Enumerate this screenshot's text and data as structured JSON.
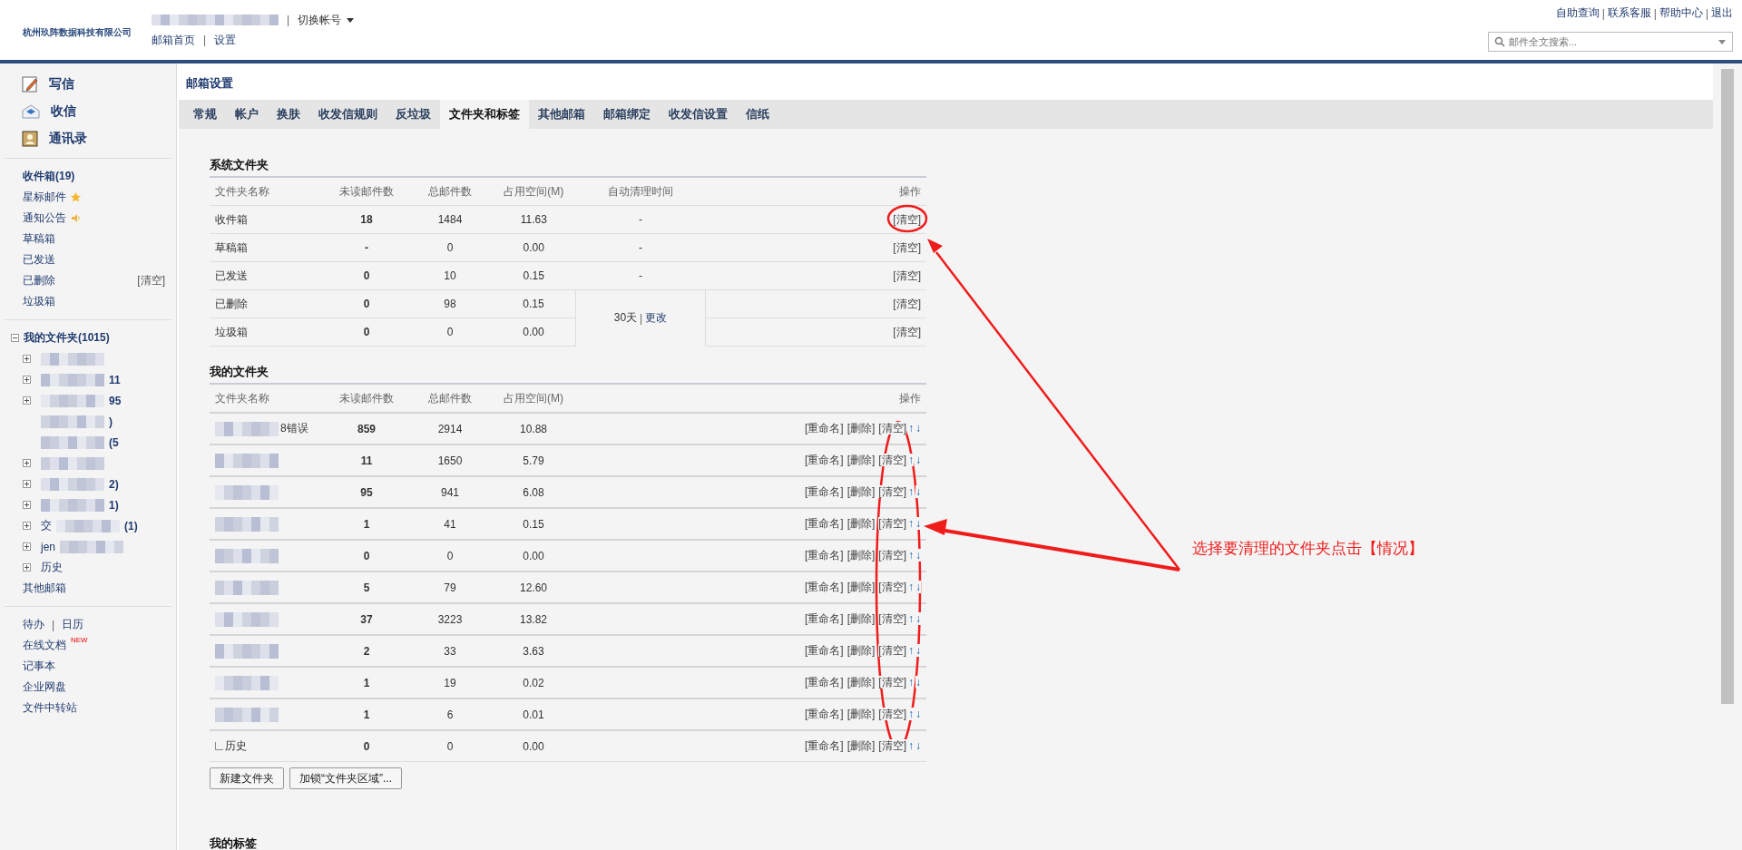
{
  "header": {
    "company": "杭州玖阵数据科技有限公司",
    "account_sep": "|",
    "switch_account": "切换帐号",
    "nav": [
      {
        "kind": "link",
        "text": "邮箱首页"
      },
      {
        "kind": "sep",
        "text": "|"
      },
      {
        "kind": "link",
        "text": "设置"
      }
    ],
    "top_links": [
      {
        "kind": "link",
        "text": "自助查询"
      },
      {
        "kind": "sep",
        "text": "|"
      },
      {
        "kind": "link",
        "text": "联系客服"
      },
      {
        "kind": "sep",
        "text": "|"
      },
      {
        "kind": "link",
        "text": "帮助中心"
      },
      {
        "kind": "sep",
        "text": "|"
      },
      {
        "kind": "link",
        "text": "退出"
      }
    ],
    "search": {
      "placeholder": "邮件全文搜索..."
    }
  },
  "sidebar": {
    "actions": [
      {
        "kind": "compose",
        "label": "写信"
      },
      {
        "kind": "inbox",
        "label": "收信"
      },
      {
        "kind": "contacts",
        "label": "通讯录"
      }
    ],
    "folders": [
      {
        "kind": "plain",
        "label": "收件箱(19)",
        "bold": true
      },
      {
        "kind": "starred",
        "label": "星标邮件",
        "bold": false
      },
      {
        "kind": "notice",
        "label": "通知公告",
        "bold": false
      },
      {
        "kind": "plain",
        "label": "草稿箱",
        "bold": false
      },
      {
        "kind": "plain",
        "label": "已发送",
        "bold": false
      },
      {
        "kind": "plain",
        "label": "已删除",
        "bold": false,
        "action": "[清空]"
      },
      {
        "kind": "plain",
        "label": "垃圾箱",
        "bold": false
      }
    ],
    "my_folders": {
      "label": "我的文件夹(1015)",
      "expanded": true,
      "children": [
        {
          "blurred": true,
          "expander": true
        },
        {
          "blurred": true,
          "suffix": "11",
          "expander": true
        },
        {
          "blurred": true,
          "suffix": "95",
          "expander": true
        },
        {
          "blurred": true,
          "suffix": ")",
          "expander": false
        },
        {
          "blurred": true,
          "suffix": "(5",
          "expander": false
        },
        {
          "blurred": true,
          "expander": true
        },
        {
          "blurred": true,
          "suffix": "2)",
          "expander": true
        },
        {
          "blurred": true,
          "suffix": "1)",
          "expander": true
        },
        {
          "blurred": true,
          "prefix": "交",
          "suffix": "(1)",
          "expander": true
        },
        {
          "blurred": true,
          "prefix": "jen",
          "expander": true
        },
        {
          "blurred": false,
          "prefix": "历史",
          "expander": true
        }
      ]
    },
    "other": "其他邮箱",
    "tools": [
      {
        "links": [
          {
            "kind": "link",
            "text": "待办"
          },
          {
            "kind": "sep",
            "text": "|"
          },
          {
            "kind": "link",
            "text": "日历"
          }
        ]
      },
      {
        "links": [
          {
            "kind": "link",
            "text": "在线文档"
          }
        ],
        "badge": "NEW"
      },
      {
        "links": [
          {
            "kind": "link",
            "text": "记事本"
          }
        ]
      },
      {
        "links": [
          {
            "kind": "link",
            "text": "企业网盘"
          }
        ]
      },
      {
        "links": [
          {
            "kind": "link",
            "text": "文件中转站"
          }
        ]
      }
    ]
  },
  "page_title": "邮箱设置",
  "tabs": [
    {
      "label": "常规",
      "selected": false
    },
    {
      "label": "帐户",
      "selected": false
    },
    {
      "label": "换肤",
      "selected": false
    },
    {
      "label": "收发信规则",
      "selected": false
    },
    {
      "label": "反垃圾",
      "selected": false
    },
    {
      "label": "文件夹和标签",
      "selected": true
    },
    {
      "label": "其他邮箱",
      "selected": false
    },
    {
      "label": "邮箱绑定",
      "selected": false
    },
    {
      "label": "收发信设置",
      "selected": false
    },
    {
      "label": "信纸",
      "selected": false
    }
  ],
  "system_folders": {
    "title": "系统文件夹",
    "columns": [
      "文件夹名称",
      "未读邮件数",
      "总邮件数",
      "占用空间(M)",
      "自动清理时间",
      "操作"
    ],
    "rows": [
      {
        "name": "收件箱",
        "unread": "18",
        "total": "1484",
        "size": "11.63",
        "auto": "-",
        "action": "[清空]"
      },
      {
        "name": "草稿箱",
        "unread": "-",
        "total": "0",
        "size": "0.00",
        "auto": "-",
        "action": "[清空]"
      },
      {
        "name": "已发送",
        "unread": "0",
        "total": "10",
        "size": "0.15",
        "auto": "-",
        "action": "[清空]"
      },
      {
        "name": "已删除",
        "unread": "0",
        "total": "98",
        "size": "0.15",
        "action": "[清空]"
      },
      {
        "name": "垃圾箱",
        "unread": "0",
        "total": "0",
        "size": "0.00",
        "action": "[清空]"
      }
    ],
    "auto_clean": {
      "days": "30天",
      "sep": "|",
      "link": "更改"
    }
  },
  "my_folders_table": {
    "title": "我的文件夹",
    "columns": [
      "文件夹名称",
      "未读邮件数",
      "总邮件数",
      "占用空间(M)",
      "操作"
    ],
    "rows": [
      {
        "name": "8错误",
        "blurred": true,
        "unread": "859",
        "total": "2914",
        "size": "10.88",
        "actions": [
          "[重命名]",
          "[删除]",
          "[清空]",
          "↑",
          "↓"
        ]
      },
      {
        "blurred": true,
        "unread": "11",
        "total": "1650",
        "size": "5.79",
        "actions": [
          "[重命名]",
          "[删除]",
          "[清空]",
          "↑",
          "↓"
        ]
      },
      {
        "blurred": true,
        "unread": "95",
        "total": "941",
        "size": "6.08",
        "actions": [
          "[重命名]",
          "[删除]",
          "[清空]",
          "↑",
          "↓"
        ]
      },
      {
        "blurred": true,
        "unread": "1",
        "total": "41",
        "size": "0.15",
        "actions": [
          "[重命名]",
          "[删除]",
          "[清空]",
          "↑",
          "↓"
        ]
      },
      {
        "blurred": true,
        "unread": "0",
        "total": "0",
        "size": "0.00",
        "actions": [
          "[重命名]",
          "[删除]",
          "[清空]",
          "↑",
          "↓"
        ]
      },
      {
        "blurred": true,
        "unread": "5",
        "total": "79",
        "size": "12.60",
        "actions": [
          "[重命名]",
          "[删除]",
          "[清空]",
          "↑",
          "↓"
        ]
      },
      {
        "blurred": true,
        "unread": "37",
        "total": "3223",
        "size": "13.82",
        "actions": [
          "[重命名]",
          "[删除]",
          "[清空]",
          "↑",
          "↓"
        ]
      },
      {
        "blurred": true,
        "unread": "2",
        "total": "33",
        "size": "3.63",
        "actions": [
          "[重命名]",
          "[删除]",
          "[清空]",
          "↑",
          "↓"
        ]
      },
      {
        "blurred": true,
        "unread": "1",
        "total": "19",
        "size": "0.02",
        "actions": [
          "[重命名]",
          "[删除]",
          "[清空]",
          "↑",
          "↓"
        ]
      },
      {
        "blurred": true,
        "unread": "1",
        "total": "6",
        "size": "0.01",
        "actions": [
          "[重命名]",
          "[删除]",
          "[清空]",
          "↑",
          "↓"
        ]
      },
      {
        "name": "历史",
        "blurred": false,
        "unread": "0",
        "total": "0",
        "size": "0.00",
        "actions": [
          "[重命名]",
          "[删除]",
          "[清空]",
          "↑",
          "↓"
        ]
      }
    ],
    "buttons": [
      "新建文件夹",
      "加锁“文件夹区域”..."
    ]
  },
  "tags_title": "我的标签",
  "annotation": {
    "text": "选择要清理的文件夹点击【情况】"
  }
}
